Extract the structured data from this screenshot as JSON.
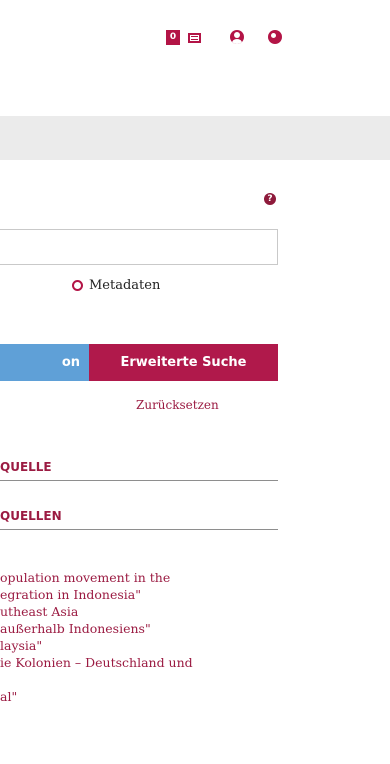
{
  "header": {
    "cart_count": "0"
  },
  "help": "?",
  "search": {
    "value": "",
    "radio_label": "Metadaten",
    "button_label": "on",
    "advanced_label": "Erweiterte Suche",
    "reset_label": "Zurücksetzen"
  },
  "sections": [
    {
      "label": "QUELLE"
    },
    {
      "label": "QUELLEN"
    }
  ],
  "results": [
    "opulation movement in the",
    "egration in Indonesia\"",
    "utheast Asia",
    "außerhalb Indonesiens\"",
    "laysia\"",
    "ie Kolonien – Deutschland und",
    "",
    "al\""
  ],
  "colors": {
    "accent": "#b0194b",
    "button_blue": "#5fa0d7",
    "band_grey": "#ebebeb"
  }
}
